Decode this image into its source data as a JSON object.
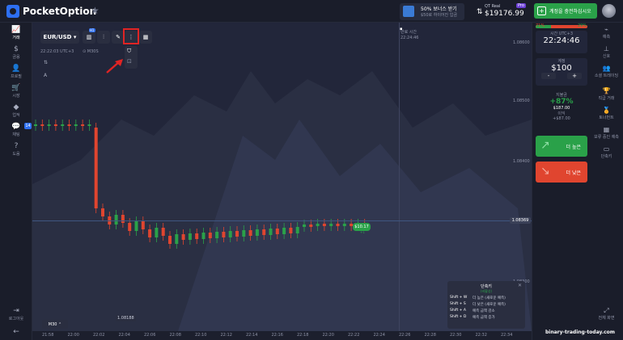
{
  "topbar": {
    "brand": "PocketOption",
    "bonus_title": "50% 보너스 받기",
    "bonus_sub": "$50로 하이어진 입금",
    "account_label": "QT Real",
    "account_pro": "Pro",
    "balance": "$19176.99",
    "deposit_label": "계정을 충전하십시오",
    "deposit_plus": "+"
  },
  "sidebar": {
    "items": [
      {
        "icon": "chart-icon",
        "glyph": "📈",
        "label": "거래"
      },
      {
        "icon": "dollar-icon",
        "glyph": "$",
        "label": "금융"
      },
      {
        "icon": "user-icon",
        "glyph": "👤",
        "label": "프로필"
      },
      {
        "icon": "cart-icon",
        "glyph": "🛒",
        "label": "시장"
      },
      {
        "icon": "diamond-icon",
        "glyph": "◆",
        "label": "업적"
      },
      {
        "icon": "chat-icon",
        "glyph": "💬",
        "label": "채팅"
      },
      {
        "icon": "help-icon",
        "glyph": "?",
        "label": "도움"
      }
    ],
    "chat_badge": "14",
    "logout_label": "로그아웃",
    "collapse_glyph": "←"
  },
  "toolbar": {
    "pair": "EUR/USD ▾",
    "timeframe": "22:22:03 UTC+3",
    "seconds": "⊙ M30S",
    "indicator_badge": "H1"
  },
  "chart": {
    "expiry_label": "만료 시간",
    "expiry_time": "22:24:46",
    "current_price": "1.08369",
    "low_price": "1.08188",
    "trade_amount": "$10.17",
    "trade_sub": "+1",
    "timeframe_btn": "M30",
    "price_ticks": [
      "1.08600",
      "1.08500",
      "1.08400",
      "1.08369",
      "1.08300",
      "1.08200"
    ],
    "time_ticks": [
      "21:58",
      "22:00",
      "22:02",
      "22:04",
      "22:06",
      "22:08",
      "22:10",
      "22:12",
      "22:14",
      "22:16",
      "22:18",
      "22:20",
      "22:22",
      "22:24",
      "22:26",
      "22:28",
      "22:30",
      "22:32",
      "22:34"
    ]
  },
  "hotkeys": {
    "title": "단축키",
    "sub": "(비활성)",
    "close": "✕",
    "rows": [
      {
        "key": "Shift + W",
        "desc": "더 높은 (새로운 예측)"
      },
      {
        "key": "Shift + S",
        "desc": "더 낮은 (새로운 예측)"
      },
      {
        "key": "Shift + A",
        "desc": "예측 금액 감소"
      },
      {
        "key": "Shift + D",
        "desc": "예측 금액 증가"
      }
    ]
  },
  "panel": {
    "red_pct": "71%",
    "green_pct": "29%",
    "green_fraction": 0.29,
    "time_caption": "시간 UTC+3",
    "time_value": "22:24:46",
    "amount_caption": "계정",
    "amount_value": "$100",
    "minus": "-",
    "plus": "+",
    "payout_caption": "지불금",
    "payout_pct": "+87%",
    "payout_amount": "$187.00",
    "profit_caption": "이익",
    "profit_value": "+$87.00",
    "up_label": "더 높은",
    "down_label": "더 낮은"
  },
  "right_sidebar": {
    "items": [
      {
        "icon": "signal-icon",
        "glyph": "⌁",
        "label": "예측"
      },
      {
        "icon": "antenna-icon",
        "glyph": "⊥",
        "label": "신호"
      },
      {
        "icon": "social-icon",
        "glyph": "👥",
        "label": "소셜 트레이딩"
      },
      {
        "icon": "trophy-icon",
        "glyph": "🏆",
        "label": "직급 거래"
      },
      {
        "icon": "tournament-icon",
        "glyph": "🏅",
        "label": "토너먼트"
      },
      {
        "icon": "bonus-icon",
        "glyph": "▦",
        "label": "보류 중인 예측"
      },
      {
        "icon": "shortcut-icon",
        "glyph": "▭",
        "label": "단축키"
      }
    ],
    "fullscreen_label": "전체 화면"
  },
  "watermark": "binary-trading-today.com",
  "colors": {
    "up": "#2aa149",
    "down": "#e0452f",
    "accent": "#2d6ff2",
    "highlight": "#e02424"
  }
}
